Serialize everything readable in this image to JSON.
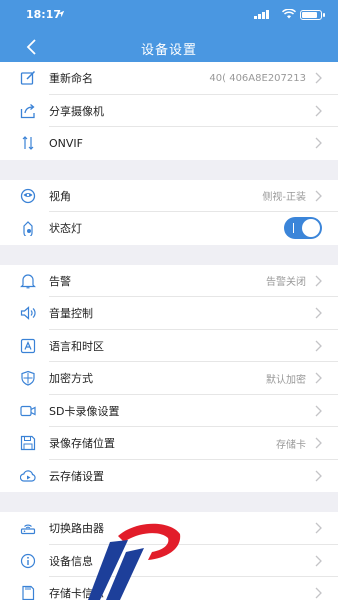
{
  "status_bar": {
    "time": "18:17"
  },
  "nav": {
    "title": "设备设置"
  },
  "groups": [
    {
      "rows": [
        {
          "label": "重新命名",
          "value": "40( 406A8E207213",
          "icon": "edit-icon"
        },
        {
          "label": "分享摄像机",
          "value": "",
          "icon": "share-icon"
        },
        {
          "label": "ONVIF",
          "value": "",
          "icon": "onvif-icon"
        }
      ]
    },
    {
      "rows": [
        {
          "label": "视角",
          "value": "侧视-正装",
          "icon": "view-angle-icon"
        },
        {
          "label": "状态灯",
          "value": "",
          "icon": "light-icon",
          "toggle": true
        }
      ]
    },
    {
      "rows": [
        {
          "label": "告警",
          "value": "告警关闭",
          "icon": "bell-icon"
        },
        {
          "label": "音量控制",
          "value": "",
          "icon": "volume-icon"
        },
        {
          "label": "语言和时区",
          "value": "",
          "icon": "language-icon"
        },
        {
          "label": "加密方式",
          "value": "默认加密",
          "icon": "shield-icon"
        },
        {
          "label": "SD卡录像设置",
          "value": "",
          "icon": "video-icon"
        },
        {
          "label": "录像存储位置",
          "value": "存储卡",
          "icon": "save-icon"
        },
        {
          "label": "云存储设置",
          "value": "",
          "icon": "cloud-icon"
        }
      ]
    },
    {
      "rows": [
        {
          "label": "切换路由器",
          "value": "",
          "icon": "router-icon"
        },
        {
          "label": "设备信息",
          "value": "",
          "icon": "info-icon"
        },
        {
          "label": "存储卡信息",
          "value": "",
          "icon": "sdcard-icon"
        }
      ]
    }
  ],
  "toggle_on": true,
  "colors": {
    "header": "#4a97e1",
    "accent": "#3b85d9",
    "watermark_red": "#e21d2a",
    "watermark_blue": "#1d3f9a"
  }
}
